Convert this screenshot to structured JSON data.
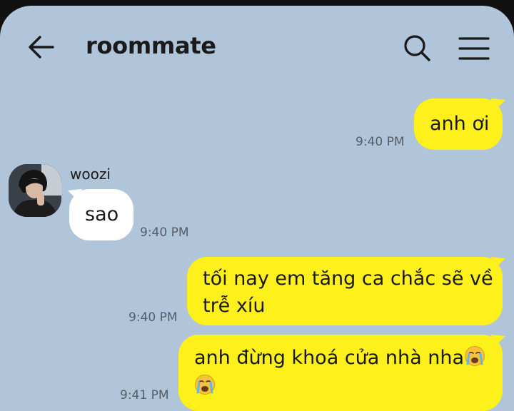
{
  "header": {
    "title": "roommate",
    "back_icon": "arrow-left-icon",
    "search_icon": "search-icon",
    "menu_icon": "hamburger-menu-icon"
  },
  "messages": [
    {
      "direction": "outgoing",
      "text": "anh ơi",
      "time": "9:40 PM"
    },
    {
      "direction": "incoming",
      "sender": "woozi",
      "text": "sao",
      "time": "9:40 PM"
    },
    {
      "direction": "outgoing",
      "line1": "tối nay em tăng ca chắc sẽ về",
      "line2": "trễ xíu",
      "time": "9:40 PM"
    },
    {
      "direction": "outgoing",
      "line1": "anh đừng khoá cửa nhà nha",
      "emoji": "loudly-crying-face-emoji",
      "time": "9:41 PM"
    }
  ],
  "colors": {
    "background": "#b0c5da",
    "outgoing_bubble": "#fef01b",
    "incoming_bubble": "#ffffff",
    "timestamp": "#555d66"
  }
}
